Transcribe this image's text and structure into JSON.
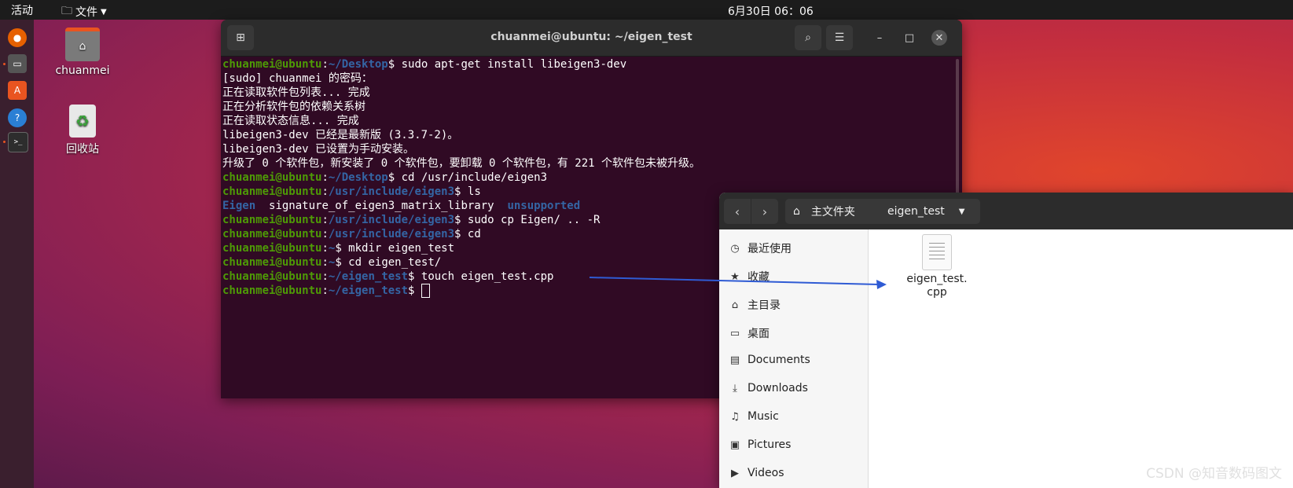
{
  "topbar": {
    "activities": "活动",
    "app_menu": "文件",
    "clock": "6月30日  06：06"
  },
  "dock": {
    "items": [
      "firefox-icon",
      "files-icon",
      "software-icon",
      "help-icon",
      "terminal-icon"
    ]
  },
  "desktop": {
    "home_label": "chuanmei",
    "trash_label": "回收站"
  },
  "terminal": {
    "title": "chuanmei@ubuntu: ~/eigen_test",
    "prompt_user": "chuanmei@ubuntu",
    "lines": [
      {
        "dir": "~/Desktop",
        "cmd": " sudo apt-get install libeigen3-dev"
      },
      {
        "text": "[sudo] chuanmei 的密码："
      },
      {
        "text": "正在读取软件包列表... 完成"
      },
      {
        "text": "正在分析软件包的依赖关系树"
      },
      {
        "text": "正在读取状态信息... 完成"
      },
      {
        "text": "libeigen3-dev 已经是最新版 (3.3.7-2)。"
      },
      {
        "text": "libeigen3-dev 已设置为手动安装。"
      },
      {
        "text": "升级了 0 个软件包，新安装了 0 个软件包，要卸载 0 个软件包，有 221 个软件包未被升级。"
      },
      {
        "dir": "~/Desktop",
        "cmd": " cd /usr/include/eigen3"
      },
      {
        "dir": "/usr/include/eigen3",
        "cmd": " ls"
      },
      {
        "ls": [
          "Eigen",
          "signature_of_eigen3_matrix_library",
          "unsupported"
        ]
      },
      {
        "dir": "/usr/include/eigen3",
        "cmd": " sudo cp Eigen/ .. -R"
      },
      {
        "dir": "/usr/include/eigen3",
        "cmd": " cd"
      },
      {
        "dir": "~",
        "cmd": " mkdir eigen_test"
      },
      {
        "dir": "~",
        "cmd": " cd eigen_test/"
      },
      {
        "dir": "~/eigen_test",
        "cmd": " touch eigen_test.cpp"
      },
      {
        "dir": "~/eigen_test",
        "cmd": " ",
        "cursor": true
      }
    ]
  },
  "files": {
    "breadcrumb_home": "主文件夹",
    "breadcrumb_current": "eigen_test",
    "sidebar": [
      {
        "icon": "clock-icon",
        "label": "最近使用"
      },
      {
        "icon": "star-icon",
        "label": "收藏"
      },
      {
        "icon": "home-icon",
        "label": "主目录"
      },
      {
        "icon": "desktop-icon",
        "label": "桌面"
      },
      {
        "icon": "document-icon",
        "label": "Documents"
      },
      {
        "icon": "download-icon",
        "label": "Downloads"
      },
      {
        "icon": "music-icon",
        "label": "Music"
      },
      {
        "icon": "picture-icon",
        "label": "Pictures"
      },
      {
        "icon": "video-icon",
        "label": "Videos"
      }
    ],
    "file_name_line1": "eigen_test.",
    "file_name_line2": "cpp"
  },
  "watermark": "CSDN @知音数码图文",
  "colors": {
    "accent": "#e95420",
    "prompt_user": "#4e9a06",
    "prompt_dir": "#3465a4",
    "arrow": "#2f5bd4"
  }
}
